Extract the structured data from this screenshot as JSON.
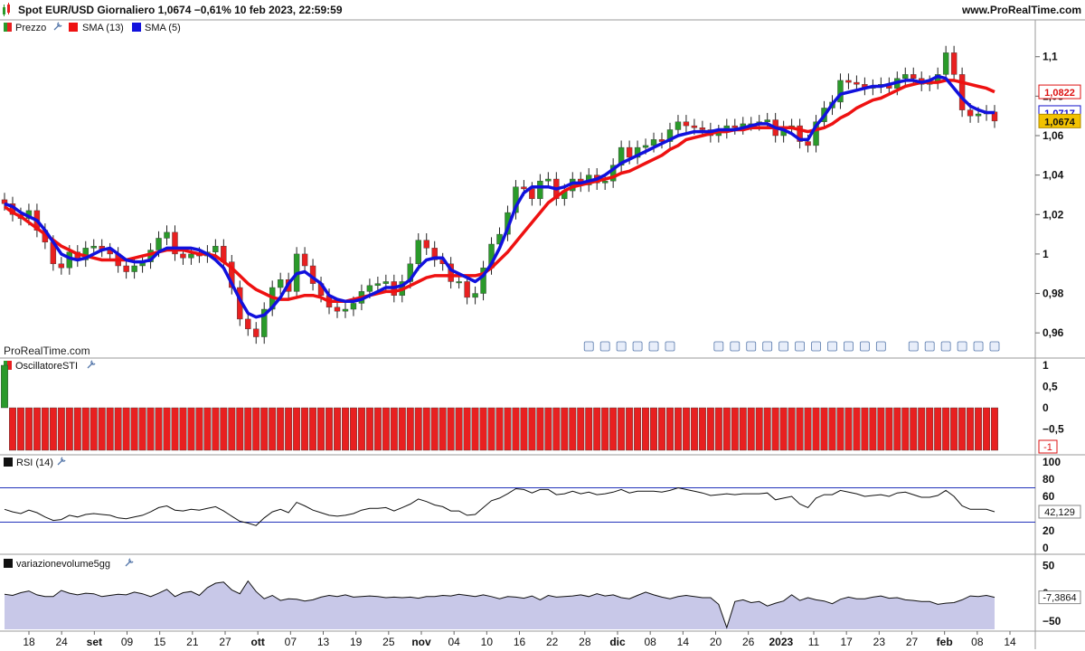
{
  "header": {
    "title": "Spot EUR/USD Giornaliero 1,0674 −0,61% 10 feb 2023, 22:59:59",
    "site": "www.ProRealTime.com",
    "watermark": "ProRealTime.com"
  },
  "colors": {
    "up": "#2a9a2a",
    "down": "#e82020",
    "sma13": "#ee1111",
    "sma5": "#1111dd",
    "price_tag_bg": "#f2c200",
    "rsi_line": "#2233bb",
    "vol_fill": "#c8c8e8"
  },
  "legend": {
    "price": "Prezzo",
    "sma13": "SMA (13)",
    "sma5": "SMA (5)",
    "oscillator": "OscillatoreSTI",
    "rsi": "RSI (14)",
    "volume": "variazionevolume5gg"
  },
  "chart_data": [
    {
      "type": "candlestick",
      "name": "price",
      "ylim": [
        0.95,
        1.115
      ],
      "yticks": [
        "1,1",
        "1,08",
        "1,06",
        "1,04",
        "1,02",
        "1",
        "0,98",
        "0,96"
      ],
      "ytick_values": [
        1.1,
        1.08,
        1.06,
        1.04,
        1.02,
        1.0,
        0.98,
        0.96
      ],
      "price_labels": {
        "sma13": "1,0822",
        "sma5": "1,0717",
        "last": "1,0674"
      },
      "sma13_value": 1.0822,
      "sma5_value": 1.0717,
      "last_value": 1.0674,
      "closes": [
        1.0255,
        1.02,
        1.018,
        1.022,
        1.012,
        1.006,
        0.995,
        0.993,
        1.001,
        0.997,
        1.003,
        1.004,
        1.002,
        1.0,
        0.994,
        0.991,
        0.994,
        0.996,
        1.002,
        1.008,
        1.011,
        1.0,
        0.998,
        1.0,
        0.999,
        1.001,
        1.004,
        0.996,
        0.983,
        0.967,
        0.962,
        0.958,
        0.972,
        0.983,
        0.987,
        0.981,
        1.0,
        0.994,
        0.985,
        0.979,
        0.973,
        0.971,
        0.972,
        0.975,
        0.981,
        0.984,
        0.985,
        0.986,
        0.979,
        0.986,
        0.995,
        1.007,
        1.003,
        0.997,
        0.995,
        0.986,
        0.986,
        0.978,
        0.98,
        0.993,
        1.005,
        1.01,
        1.021,
        1.034,
        1.033,
        1.028,
        1.037,
        1.038,
        1.028,
        1.032,
        1.038,
        1.035,
        1.04,
        1.036,
        1.037,
        1.045,
        1.054,
        1.049,
        1.054,
        1.055,
        1.058,
        1.057,
        1.063,
        1.067,
        1.065,
        1.064,
        1.063,
        1.06,
        1.062,
        1.065,
        1.064,
        1.066,
        1.066,
        1.067,
        1.068,
        1.06,
        1.064,
        1.065,
        1.057,
        1.055,
        1.067,
        1.074,
        1.077,
        1.088,
        1.087,
        1.086,
        1.084,
        1.085,
        1.086,
        1.084,
        1.089,
        1.091,
        1.089,
        1.086,
        1.087,
        1.091,
        1.102,
        1.091,
        1.073,
        1.07,
        1.071,
        1.072,
        1.0674
      ],
      "overlays": [
        {
          "name": "SMA (13)",
          "color": "#ee1111",
          "values": [
            1.024,
            1.021,
            1.019,
            1.016,
            1.013,
            1.01,
            1.007,
            1.004,
            1.002,
            1.0,
            0.999,
            0.998,
            0.997,
            0.997,
            0.997,
            0.997,
            0.998,
            0.999,
            1.0,
            1.001,
            1.002,
            1.002,
            1.002,
            1.001,
            1.0,
            1.0,
            0.999,
            0.996,
            0.993,
            0.989,
            0.985,
            0.982,
            0.98,
            0.978,
            0.977,
            0.977,
            0.978,
            0.979,
            0.979,
            0.978,
            0.976,
            0.976,
            0.976,
            0.977,
            0.978,
            0.979,
            0.98,
            0.981,
            0.981,
            0.982,
            0.984,
            0.986,
            0.988,
            0.989,
            0.989,
            0.989,
            0.989,
            0.989,
            0.989,
            0.99,
            0.993,
            0.997,
            1.001,
            1.006,
            1.011,
            1.016,
            1.021,
            1.026,
            1.029,
            1.032,
            1.034,
            1.035,
            1.036,
            1.037,
            1.038,
            1.039,
            1.041,
            1.042,
            1.044,
            1.046,
            1.048,
            1.05,
            1.053,
            1.055,
            1.058,
            1.059,
            1.06,
            1.061,
            1.062,
            1.062,
            1.063,
            1.063,
            1.064,
            1.064,
            1.064,
            1.064,
            1.064,
            1.064,
            1.063,
            1.062,
            1.063,
            1.064,
            1.066,
            1.069,
            1.071,
            1.074,
            1.076,
            1.078,
            1.079,
            1.081,
            1.083,
            1.085,
            1.086,
            1.087,
            1.087,
            1.087,
            1.088,
            1.088,
            1.087,
            1.086,
            1.085,
            1.084,
            1.0822
          ]
        },
        {
          "name": "SMA (5)",
          "color": "#1111dd",
          "values": [
            1.0255,
            1.024,
            1.021,
            1.019,
            1.017,
            1.012,
            1.006,
            1.0,
            0.998,
            0.997,
            0.998,
            1.0,
            1.002,
            1.003,
            1.0,
            0.997,
            0.996,
            0.996,
            0.997,
            1.001,
            1.003,
            1.003,
            1.003,
            1.003,
            1.002,
            1.0,
            0.997,
            0.993,
            0.985,
            0.977,
            0.97,
            0.968,
            0.969,
            0.973,
            0.978,
            0.985,
            0.99,
            0.991,
            0.988,
            0.985,
            0.979,
            0.977,
            0.976,
            0.976,
            0.977,
            0.979,
            0.981,
            0.983,
            0.983,
            0.984,
            0.987,
            0.993,
            0.997,
            0.998,
            0.998,
            0.992,
            0.99,
            0.988,
            0.986,
            0.989,
            0.995,
            1.003,
            1.013,
            1.024,
            1.031,
            1.034,
            1.034,
            1.034,
            1.033,
            1.034,
            1.036,
            1.036,
            1.037,
            1.038,
            1.04,
            1.043,
            1.046,
            1.048,
            1.05,
            1.052,
            1.054,
            1.056,
            1.058,
            1.06,
            1.061,
            1.062,
            1.062,
            1.062,
            1.063,
            1.063,
            1.063,
            1.064,
            1.065,
            1.066,
            1.066,
            1.064,
            1.063,
            1.061,
            1.058,
            1.058,
            1.065,
            1.07,
            1.076,
            1.081,
            1.082,
            1.083,
            1.084,
            1.085,
            1.085,
            1.086,
            1.087,
            1.088,
            1.088,
            1.087,
            1.088,
            1.09,
            1.089,
            1.084,
            1.079,
            1.075,
            1.073,
            1.0717,
            1.0717
          ]
        }
      ]
    },
    {
      "type": "bar",
      "name": "OscillatoreSTI",
      "ylim": [
        -1,
        1
      ],
      "yticks": [
        "1",
        "0,5",
        "0",
        "−0,5"
      ],
      "ytick_values": [
        1,
        0.5,
        0,
        -0.5
      ],
      "last_label": "-1",
      "values": [
        1,
        -1,
        -1,
        -1,
        -1,
        -1,
        -1,
        -1,
        -1,
        -1,
        -1,
        -1,
        -1,
        -1,
        -1,
        -1,
        -1,
        -1,
        -1,
        -1,
        -1,
        -1,
        -1,
        -1,
        -1,
        -1,
        -1,
        -1,
        -1,
        -1,
        -1,
        -1,
        -1,
        -1,
        -1,
        -1,
        -1,
        -1,
        -1,
        -1,
        -1,
        -1,
        -1,
        -1,
        -1,
        -1,
        -1,
        -1,
        -1,
        -1,
        -1,
        -1,
        -1,
        -1,
        -1,
        -1,
        -1,
        -1,
        -1,
        -1,
        -1,
        -1,
        -1,
        -1,
        -1,
        -1,
        -1,
        -1,
        -1,
        -1,
        -1,
        -1,
        -1,
        -1,
        -1,
        -1,
        -1,
        -1,
        -1,
        -1,
        -1,
        -1,
        -1,
        -1,
        -1,
        -1,
        -1,
        -1,
        -1,
        -1,
        -1,
        -1,
        -1,
        -1,
        -1,
        -1,
        -1,
        -1,
        -1,
        -1,
        -1,
        -1,
        -1,
        -1,
        -1,
        -1,
        -1,
        -1,
        -1,
        -1,
        -1,
        -1,
        -1,
        -1,
        -1,
        -1,
        -1,
        -1,
        -1,
        -1,
        -1,
        -1,
        -1
      ]
    },
    {
      "type": "line",
      "name": "RSI (14)",
      "ylim": [
        0,
        100
      ],
      "yticks": [
        "100",
        "80",
        "60",
        "40",
        "20",
        "0"
      ],
      "ytick_values": [
        100,
        80,
        60,
        40,
        20,
        0
      ],
      "levels": [
        70,
        30
      ],
      "last_label": "42,129",
      "values": [
        45,
        42,
        40,
        44,
        41,
        36,
        32,
        33,
        38,
        36,
        39,
        40,
        39,
        38,
        35,
        34,
        36,
        38,
        42,
        47,
        49,
        44,
        43,
        45,
        44,
        46,
        48,
        43,
        37,
        31,
        29,
        26,
        35,
        42,
        45,
        41,
        53,
        49,
        44,
        41,
        38,
        37,
        38,
        40,
        44,
        46,
        46,
        47,
        43,
        47,
        51,
        57,
        54,
        50,
        48,
        43,
        43,
        38,
        39,
        47,
        55,
        58,
        63,
        69,
        68,
        64,
        68,
        68,
        62,
        63,
        66,
        63,
        65,
        62,
        63,
        65,
        68,
        64,
        66,
        66,
        66,
        65,
        67,
        70,
        68,
        66,
        64,
        61,
        62,
        63,
        62,
        63,
        63,
        63,
        64,
        56,
        58,
        60,
        51,
        47,
        58,
        62,
        62,
        67,
        65,
        63,
        60,
        61,
        62,
        60,
        64,
        65,
        62,
        59,
        59,
        61,
        67,
        60,
        49,
        45,
        45,
        45,
        42.129
      ]
    },
    {
      "type": "area",
      "name": "variazionevolume5gg",
      "ylim": [
        -65,
        62
      ],
      "yticks": [
        "50",
        "0",
        "−50"
      ],
      "ytick_values": [
        50,
        0,
        -50
      ],
      "last_label": "-7,3864",
      "x_labels": [
        "18",
        "24",
        "set",
        "09",
        "15",
        "21",
        "27",
        "ott",
        "07",
        "13",
        "19",
        "25",
        "nov",
        "04",
        "10",
        "16",
        "22",
        "28",
        "dic",
        "08",
        "14",
        "20",
        "26",
        "2023",
        "11",
        "17",
        "23",
        "27",
        "feb",
        "08",
        "14"
      ],
      "values": [
        -2,
        -4,
        1,
        4,
        -3,
        -6,
        -6,
        5,
        0,
        -3,
        0,
        -1,
        -6,
        -4,
        -2,
        -3,
        2,
        -1,
        -6,
        0,
        7,
        -6,
        1,
        3,
        -4,
        10,
        18,
        20,
        6,
        -1,
        22,
        3,
        -10,
        -4,
        -13,
        -10,
        -11,
        -14,
        -12,
        -7,
        -4,
        -6,
        -3,
        -7,
        -6,
        -5,
        -6,
        -8,
        -7,
        -8,
        -7,
        -9,
        -6,
        -6,
        -4,
        -5,
        -2,
        -4,
        -6,
        -3,
        -6,
        -10,
        -6,
        -7,
        -9,
        -5,
        -12,
        -4,
        -7,
        -6,
        -5,
        -3,
        -6,
        -1,
        -5,
        -3,
        -8,
        -10,
        -4,
        2,
        -3,
        -7,
        -10,
        -6,
        -4,
        -6,
        -8,
        -8,
        -20,
        -62,
        -15,
        -12,
        -17,
        -15,
        -23,
        -18,
        -14,
        -3,
        -13,
        -8,
        -12,
        -14,
        -19,
        -11,
        -7,
        -10,
        -10,
        -7,
        -5,
        -9,
        -8,
        -12,
        -13,
        -15,
        -15,
        -20,
        -18,
        -17,
        -12,
        -5,
        -6,
        -4,
        -7.3864
      ]
    }
  ]
}
